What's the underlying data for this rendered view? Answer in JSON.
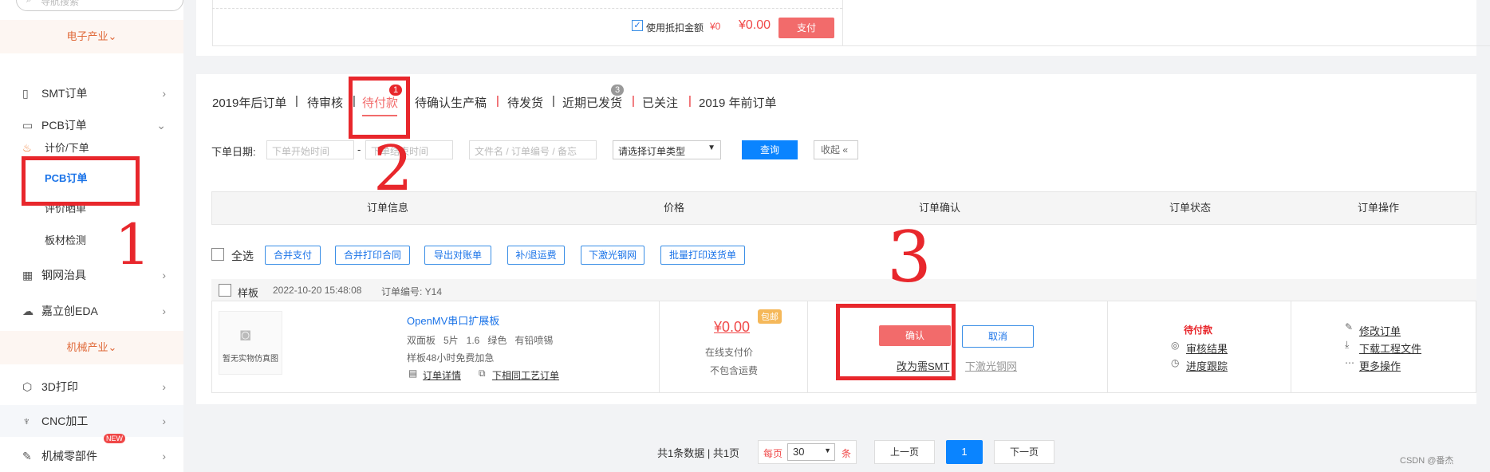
{
  "sidebar": {
    "search_placeholder": "导航搜索",
    "cat1": "电子产业",
    "cat2": "机械产业",
    "items": [
      {
        "label": "SMT订单"
      },
      {
        "label": "PCB订单"
      },
      {
        "label": "钢网治具"
      },
      {
        "label": "嘉立创EDA"
      },
      {
        "label": "3D打印"
      },
      {
        "label": "CNC加工"
      },
      {
        "label": "机械零部件"
      }
    ],
    "subs": [
      "计价/下单",
      "PCB订单",
      "评价晒单",
      "板材检测"
    ],
    "new_badge": "NEW"
  },
  "payment": {
    "use_deduction": "使用抵扣金额",
    "deduction_amount": "¥0",
    "total": "¥0.00",
    "pay_label": "支付"
  },
  "tabs": [
    {
      "label": "2019年后订单"
    },
    {
      "label": "待审核"
    },
    {
      "label": "待付款",
      "badge": "1"
    },
    {
      "label": "待确认生产稿"
    },
    {
      "label": "待发货"
    },
    {
      "label": "近期已发货",
      "badge": "3"
    },
    {
      "label": "已关注"
    },
    {
      "label": "2019 年前订单"
    }
  ],
  "filter": {
    "date_label": "下单日期:",
    "start_ph": "下单开始时间",
    "dash": "-",
    "end_ph": "下单结束时间",
    "keyword_ph": "文件名 / 订单编号 / 备忘",
    "type_select": "请选择订单类型",
    "query": "查询",
    "collapse": "收起"
  },
  "table_headers": [
    "订单信息",
    "价格",
    "订单确认",
    "订单状态",
    "订单操作"
  ],
  "bulk": {
    "select_all": "全选",
    "buttons": [
      "合并支付",
      "合并打印合同",
      "导出对账单",
      "补/退运费",
      "下激光钢网",
      "批量打印送货单"
    ]
  },
  "order": {
    "type": "样板",
    "datetime": "2022-10-20 15:48:08",
    "number": "订单编号: Y14",
    "no_image": "暂无实物仿真图",
    "name": "OpenMV串口扩展板",
    "specs": "双面板   5片   1.6   绿色   有铅喷锡",
    "note": "样板48小时免费加急",
    "detail_link": "订单详情",
    "same_process": "下相同工艺订单",
    "price": "¥0.00",
    "free_ship": "包邮",
    "price_note1": "在线支付价",
    "price_note2": "不包含运费",
    "confirm": "确认",
    "cancel": "取消",
    "change_smt": "改为需SMT",
    "laser_mesh": "下激光钢网",
    "status": "待付款",
    "review_result": "审核结果",
    "progress": "进度跟踪",
    "modify": "修改订单",
    "download": "下载工程文件",
    "more": "更多操作"
  },
  "pagination": {
    "summary": "共1条数据 | 共1页",
    "per_page": "每页",
    "page_size": "30",
    "unit": "条",
    "prev": "上一页",
    "current": "1",
    "next": "下一页"
  },
  "annotations": {
    "a1": "1",
    "a2": "2",
    "a3": "3"
  },
  "watermark": "CSDN @番杰",
  "colors": {
    "accent": "#f26b6b",
    "blue": "#1a73e8",
    "annot_red": "#e8272c"
  }
}
